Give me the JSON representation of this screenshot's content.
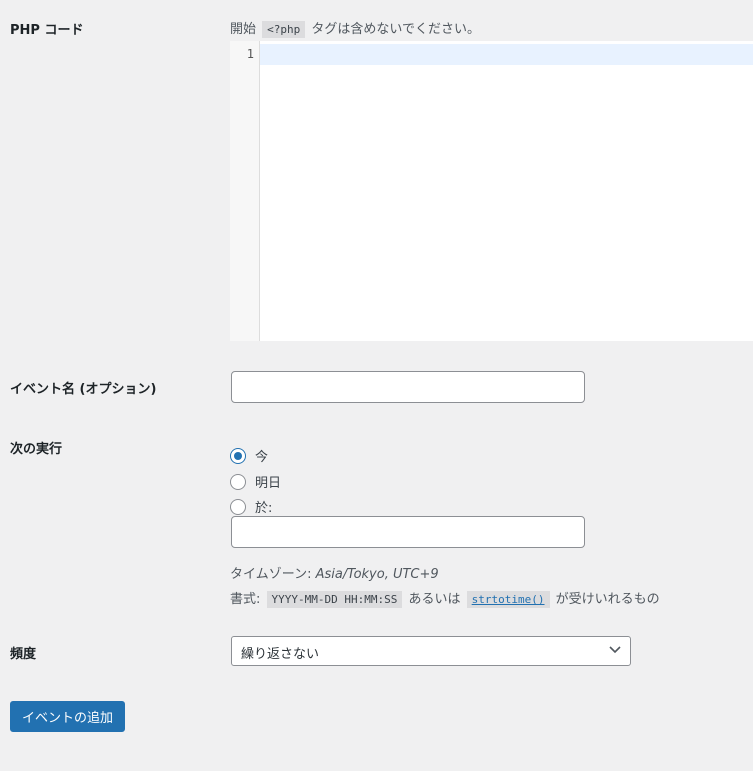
{
  "php_code": {
    "label": "PHP コード",
    "desc_before": "開始",
    "desc_code": "<?php",
    "desc_after": "タグは含めないでください。",
    "line_number": "1"
  },
  "event_name": {
    "label": "イベント名 (オプション)",
    "value": ""
  },
  "next_run": {
    "label": "次の実行",
    "options": [
      {
        "label": "今",
        "checked": true
      },
      {
        "label": "明日",
        "checked": false
      },
      {
        "label": "於:",
        "checked": false
      }
    ],
    "datetime_value": "",
    "timezone_prefix": "タイムゾーン: ",
    "timezone_value": "Asia/Tokyo, UTC+9",
    "format_prefix": "書式:",
    "format_code": "YYYY-MM-DD HH:MM:SS",
    "format_or": "あるいは",
    "format_link": "strtotime()",
    "format_suffix": "が受けいれるもの"
  },
  "frequency": {
    "label": "頻度",
    "selected": "繰り返さない"
  },
  "submit": {
    "label": "イベントの追加"
  }
}
